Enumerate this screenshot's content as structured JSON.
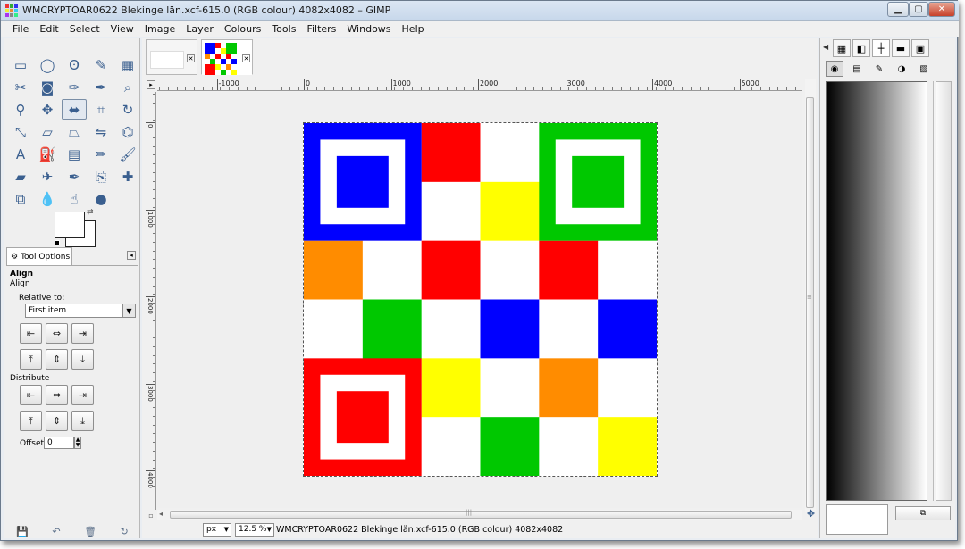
{
  "window": {
    "title": "WMCRYPTOAR0622 Blekinge län.xcf-615.0 (RGB colour) 4082x4082 – GIMP",
    "minimize_glyph": "▁",
    "maximize_glyph": "▢",
    "close_glyph": "✕"
  },
  "menubar": {
    "items": [
      "File",
      "Edit",
      "Select",
      "View",
      "Image",
      "Layer",
      "Colours",
      "Tools",
      "Filters",
      "Windows",
      "Help"
    ]
  },
  "toolbox": {
    "tools": [
      {
        "name": "rect-select-icon",
        "glyph": "▭"
      },
      {
        "name": "ellipse-select-icon",
        "glyph": "◯"
      },
      {
        "name": "free-select-icon",
        "glyph": "ʘ"
      },
      {
        "name": "fuzzy-select-icon",
        "glyph": "✎"
      },
      {
        "name": "select-by-color-icon",
        "glyph": "▦"
      },
      {
        "name": "scissors-icon",
        "glyph": "✂"
      },
      {
        "name": "foreground-select-icon",
        "glyph": "◙"
      },
      {
        "name": "paths-icon",
        "glyph": "✑"
      },
      {
        "name": "color-picker-icon",
        "glyph": "✒"
      },
      {
        "name": "zoom-icon",
        "glyph": "⌕"
      },
      {
        "name": "measure-icon",
        "glyph": "⚲"
      },
      {
        "name": "move-icon",
        "glyph": "✥"
      },
      {
        "name": "align-icon",
        "glyph": "⬌"
      },
      {
        "name": "crop-icon",
        "glyph": "⌗"
      },
      {
        "name": "rotate-icon",
        "glyph": "↻"
      },
      {
        "name": "scale-icon",
        "glyph": "⤡"
      },
      {
        "name": "shear-icon",
        "glyph": "▱"
      },
      {
        "name": "perspective-icon",
        "glyph": "⏢"
      },
      {
        "name": "flip-icon",
        "glyph": "⇋"
      },
      {
        "name": "cage-icon",
        "glyph": "⌬"
      },
      {
        "name": "text-icon",
        "glyph": "A"
      },
      {
        "name": "bucket-fill-icon",
        "glyph": "⛽"
      },
      {
        "name": "blend-icon",
        "glyph": "▤"
      },
      {
        "name": "pencil-icon",
        "glyph": "✏"
      },
      {
        "name": "paintbrush-icon",
        "glyph": "🖌"
      },
      {
        "name": "eraser-icon",
        "glyph": "▰"
      },
      {
        "name": "airbrush-icon",
        "glyph": "✈"
      },
      {
        "name": "ink-icon",
        "glyph": "✒"
      },
      {
        "name": "clone-icon",
        "glyph": "⎘"
      },
      {
        "name": "heal-icon",
        "glyph": "✚"
      },
      {
        "name": "perspective-clone-icon",
        "glyph": "⧉"
      },
      {
        "name": "blur-icon",
        "glyph": "💧"
      },
      {
        "name": "smudge-icon",
        "glyph": "☝"
      },
      {
        "name": "dodge-burn-icon",
        "glyph": "●"
      }
    ],
    "tool_options_tab": "Tool Options",
    "panel_menu_glyph": "◂",
    "options": {
      "title": "Align",
      "subtitle": "Align",
      "relative_label": "Relative to:",
      "relative_value": "First item",
      "distribute_label": "Distribute",
      "offset_label": "Offset:",
      "offset_value": "0"
    },
    "align_buttons_row1": [
      "⇤",
      "⇔",
      "⇥"
    ],
    "align_buttons_row2": [
      "⤒",
      "⇕",
      "⤓"
    ],
    "distribute_row1": [
      "⇤",
      "⇔",
      "⇥"
    ],
    "distribute_row2": [
      "⤒",
      "⇕",
      "⤓"
    ],
    "bottom_icons": [
      "💾",
      "↶",
      "🗑",
      "↻"
    ]
  },
  "tabs": {
    "close_glyph": "✕"
  },
  "rulers": {
    "h_labels": [
      "-1000",
      "0",
      "1000",
      "2000",
      "3000",
      "4000",
      "5000"
    ],
    "v_labels": [
      "0",
      "1000",
      "2000",
      "3000",
      "4000"
    ]
  },
  "statusbar": {
    "unit": "px",
    "zoom": "12.5 %",
    "text": "WMCRYPTOAR0622 Blekinge län.xcf-615.0 (RGB colour) 4082x4082"
  },
  "image_grid": {
    "colors": {
      "R": "#ff0000",
      "G": "#00c800",
      "B": "#0000ff",
      "Y": "#ffff00",
      "O": "#ff8c00",
      "W": "#ffffff"
    },
    "rows": [
      [
        "F",
        "F",
        "R",
        "W",
        "F",
        "F"
      ],
      [
        "F",
        "F",
        "W",
        "Y",
        "F",
        "F"
      ],
      [
        "O",
        "W",
        "R",
        "W",
        "R",
        "W"
      ],
      [
        "W",
        "G",
        "W",
        "B",
        "W",
        "B"
      ],
      [
        "F",
        "F",
        "Y",
        "W",
        "O",
        "W"
      ],
      [
        "F",
        "F",
        "W",
        "G",
        "W",
        "Y"
      ]
    ],
    "finders": [
      {
        "pos": "top-left",
        "color": "B"
      },
      {
        "pos": "top-right",
        "color": "G"
      },
      {
        "pos": "bottom-left",
        "color": "R"
      }
    ]
  },
  "dock": {
    "top_tabs": [
      "▦",
      "◧",
      "┼",
      "▬",
      "▣"
    ],
    "row2": [
      "◉",
      "▤",
      "✎",
      "◑",
      "▧"
    ],
    "bottom_button": "⧉"
  }
}
